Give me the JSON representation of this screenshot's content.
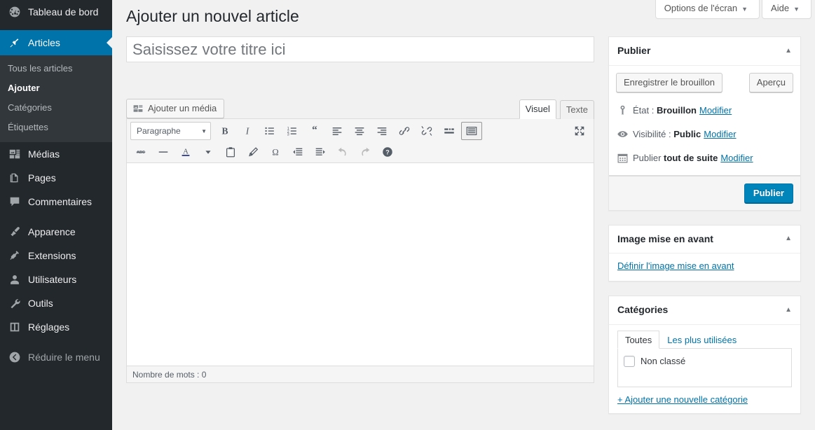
{
  "sidebar": {
    "items": [
      {
        "label": "Tableau de bord",
        "icon": "dashboard-icon",
        "name": "sidebar-item-dashboard",
        "current": false
      },
      {
        "label": "Articles",
        "icon": "pin-icon",
        "name": "sidebar-item-posts",
        "current": true
      },
      {
        "label": "Médias",
        "icon": "media-icon",
        "name": "sidebar-item-media",
        "current": false
      },
      {
        "label": "Pages",
        "icon": "pages-icon",
        "name": "sidebar-item-pages",
        "current": false
      },
      {
        "label": "Commentaires",
        "icon": "comment-icon",
        "name": "sidebar-item-comments",
        "current": false
      },
      {
        "label": "Apparence",
        "icon": "brush-icon",
        "name": "sidebar-item-appearance",
        "current": false
      },
      {
        "label": "Extensions",
        "icon": "plugin-icon",
        "name": "sidebar-item-plugins",
        "current": false
      },
      {
        "label": "Utilisateurs",
        "icon": "user-icon",
        "name": "sidebar-item-users",
        "current": false
      },
      {
        "label": "Outils",
        "icon": "wrench-icon",
        "name": "sidebar-item-tools",
        "current": false
      },
      {
        "label": "Réglages",
        "icon": "settings-icon",
        "name": "sidebar-item-settings",
        "current": false
      },
      {
        "label": "Réduire le menu",
        "icon": "collapse-icon",
        "name": "sidebar-item-collapse",
        "current": false
      }
    ],
    "submenu": [
      {
        "label": "Tous les articles",
        "current": false
      },
      {
        "label": "Ajouter",
        "current": true
      },
      {
        "label": "Catégories",
        "current": false
      },
      {
        "label": "Étiquettes",
        "current": false
      }
    ],
    "accent_color": "#0073aa",
    "background_color": "#23282d",
    "submenu_background_color": "#32373c"
  },
  "screen_meta": {
    "screen_options_label": "Options de l'écran",
    "help_label": "Aide",
    "caret": "▼"
  },
  "page": {
    "title": "Ajouter un nouvel article"
  },
  "title_field": {
    "value": "",
    "placeholder": "Saisissez votre titre ici"
  },
  "editor": {
    "add_media_label": "Ajouter un média",
    "tabs": [
      {
        "label": "Visuel",
        "active": true
      },
      {
        "label": "Texte",
        "active": false
      }
    ],
    "format_select": {
      "value": "Paragraphe",
      "caret": "▼"
    },
    "toolbar_row1": [
      {
        "name": "bold-icon",
        "title": "Gras"
      },
      {
        "name": "italic-icon",
        "title": "Italique"
      },
      {
        "name": "bulleted-list-icon",
        "title": "Liste à puces"
      },
      {
        "name": "numbered-list-icon",
        "title": "Liste numérotée"
      },
      {
        "name": "blockquote-icon",
        "title": "Citation"
      },
      {
        "name": "align-left-icon",
        "title": "Aligner à gauche"
      },
      {
        "name": "align-center-icon",
        "title": "Centrer"
      },
      {
        "name": "align-right-icon",
        "title": "Aligner à droite"
      },
      {
        "name": "link-icon",
        "title": "Insérer un lien"
      },
      {
        "name": "unlink-icon",
        "title": "Supprimer le lien"
      },
      {
        "name": "read-more-icon",
        "title": "Insérer la balise Lire la suite"
      },
      {
        "name": "kitchen-sink-icon",
        "title": "Plus d'outils"
      }
    ],
    "toolbar_row1_right": [
      {
        "name": "fullscreen-icon",
        "title": "Plein écran"
      }
    ],
    "toolbar_row2": [
      {
        "name": "strikethrough-icon",
        "title": "Barré"
      },
      {
        "name": "horizontal-rule-icon",
        "title": "Ligne horizontale"
      },
      {
        "name": "text-color-icon",
        "title": "Couleur du texte"
      },
      {
        "name": "text-color-caret-icon",
        "title": "Choisir la couleur"
      },
      {
        "name": "paste-as-text-icon",
        "title": "Coller en texte"
      },
      {
        "name": "clear-formatting-icon",
        "title": "Effacer la mise en forme"
      },
      {
        "name": "special-character-icon",
        "title": "Caractère spécial"
      },
      {
        "name": "outdent-icon",
        "title": "Diminuer le retrait"
      },
      {
        "name": "indent-icon",
        "title": "Augmenter le retrait"
      },
      {
        "name": "undo-icon",
        "title": "Annuler"
      },
      {
        "name": "redo-icon",
        "title": "Rétablir"
      },
      {
        "name": "keyboard-shortcuts-icon",
        "title": "Raccourcis clavier"
      }
    ],
    "statusbar": "Nombre de mots : 0",
    "content": ""
  },
  "publish_box": {
    "title": "Publier",
    "toggle": "▲",
    "save_draft_label": "Enregistrer le brouillon",
    "preview_label": "Aperçu",
    "status": {
      "label": "État :",
      "value": "Brouillon",
      "edit": "Modifier",
      "icon": "post-status-icon"
    },
    "visibility": {
      "label": "Visibilité :",
      "value": "Public",
      "edit": "Modifier",
      "icon": "eye-icon"
    },
    "schedule": {
      "label": "Publier",
      "value": "tout de suite",
      "edit": "Modifier",
      "icon": "calendar-icon"
    },
    "publish_label": "Publier",
    "primary_color": "#0085ba"
  },
  "featured_image_box": {
    "title": "Image mise en avant",
    "toggle": "▲",
    "set_link": "Définir l'image mise en avant"
  },
  "categories_box": {
    "title": "Catégories",
    "toggle": "▲",
    "tabs": [
      {
        "label": "Toutes",
        "active": true
      },
      {
        "label": "Les plus utilisées",
        "active": false
      }
    ],
    "items": [
      {
        "label": "Non classé",
        "checked": false
      }
    ],
    "add_new_label": "+ Ajouter une nouvelle catégorie"
  }
}
